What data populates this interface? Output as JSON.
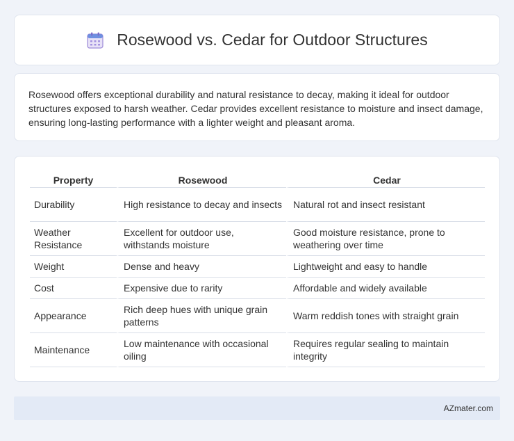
{
  "header": {
    "icon": "calendar-icon",
    "title": "Rosewood vs. Cedar for Outdoor Structures"
  },
  "summary": {
    "text": "Rosewood offers exceptional durability and natural resistance to decay, making it ideal for outdoor structures exposed to harsh weather. Cedar provides excellent resistance to moisture and insect damage, ensuring long-lasting performance with a lighter weight and pleasant aroma."
  },
  "table": {
    "headers": [
      "Property",
      "Rosewood",
      "Cedar"
    ],
    "rows": [
      [
        "Durability",
        "High resistance to decay and insects",
        "Natural rot and insect resistant"
      ],
      [
        "Weather Resistance",
        "Excellent for outdoor use, withstands moisture",
        "Good moisture resistance, prone to weathering over time"
      ],
      [
        "Weight",
        "Dense and heavy",
        "Lightweight and easy to handle"
      ],
      [
        "Cost",
        "Expensive due to rarity",
        "Affordable and widely available"
      ],
      [
        "Appearance",
        "Rich deep hues with unique grain patterns",
        "Warm reddish tones with straight grain"
      ],
      [
        "Maintenance",
        "Low maintenance with occasional oiling",
        "Requires regular sealing to maintain integrity"
      ]
    ]
  },
  "footer": {
    "text": "AZmater.com"
  }
}
